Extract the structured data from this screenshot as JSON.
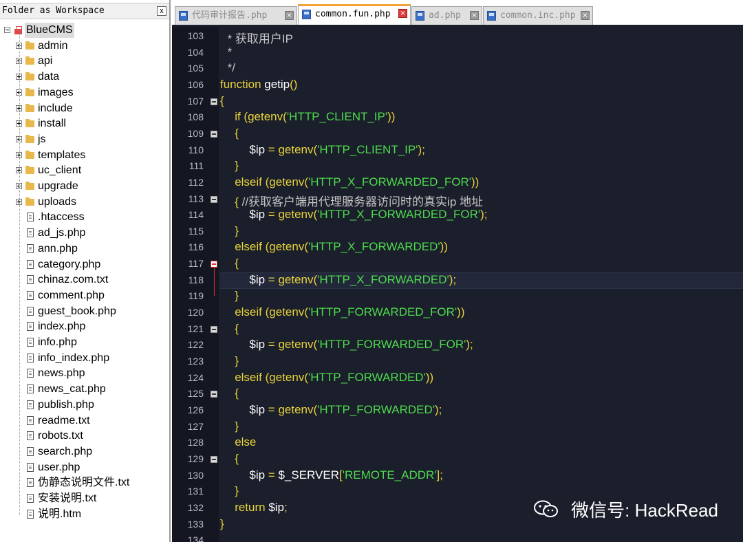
{
  "folder_panel": {
    "title": "Folder as Workspace",
    "close_label": "x",
    "root": "BlueCMS",
    "folders": [
      "admin",
      "api",
      "data",
      "images",
      "include",
      "install",
      "js",
      "templates",
      "uc_client",
      "upgrade",
      "uploads"
    ],
    "files": [
      ".htaccess",
      "ad_js.php",
      "ann.php",
      "category.php",
      "chinaz.com.txt",
      "comment.php",
      "guest_book.php",
      "index.php",
      "info.php",
      "info_index.php",
      "news.php",
      "news_cat.php",
      "publish.php",
      "readme.txt",
      "robots.txt",
      "search.php",
      "user.php",
      "伪静态说明文件.txt",
      "安装说明.txt",
      "说明.htm"
    ]
  },
  "tabs": [
    {
      "label": "代码审计报告.php",
      "active": false
    },
    {
      "label": "common.fun.php",
      "active": true
    },
    {
      "label": "ad.php",
      "active": false
    },
    {
      "label": "common.inc.php",
      "active": false
    }
  ],
  "editor": {
    "lines": [
      {
        "n": "103",
        "indent": 1,
        "tokens": [
          [
            "cm",
            "* 获取用户IP"
          ]
        ]
      },
      {
        "n": "104",
        "indent": 1,
        "tokens": [
          [
            "cm",
            "*"
          ]
        ]
      },
      {
        "n": "105",
        "indent": 1,
        "tokens": [
          [
            "cm",
            "*/"
          ]
        ]
      },
      {
        "n": "106",
        "indent": 0,
        "tokens": [
          [
            "kw",
            "function "
          ],
          [
            "fn",
            "getip"
          ],
          [
            "pn",
            "()"
          ]
        ]
      },
      {
        "n": "107",
        "indent": 0,
        "fold": "box",
        "tokens": [
          [
            "pn",
            "{"
          ]
        ]
      },
      {
        "n": "108",
        "indent": 2,
        "tokens": [
          [
            "kw",
            "if "
          ],
          [
            "pn",
            "("
          ],
          [
            "bf",
            "getenv"
          ],
          [
            "pn",
            "("
          ],
          [
            "st",
            "'HTTP_CLIENT_IP'"
          ],
          [
            "pn",
            "))"
          ]
        ]
      },
      {
        "n": "109",
        "indent": 2,
        "fold": "box",
        "tokens": [
          [
            "pn",
            "{"
          ]
        ]
      },
      {
        "n": "110",
        "indent": 4,
        "tokens": [
          [
            "vr",
            "$ip"
          ],
          [
            "op",
            " = "
          ],
          [
            "bf",
            "getenv"
          ],
          [
            "pn",
            "("
          ],
          [
            "st",
            "'HTTP_CLIENT_IP'"
          ],
          [
            "pn",
            ");"
          ]
        ]
      },
      {
        "n": "111",
        "indent": 2,
        "tokens": [
          [
            "pn",
            "}"
          ]
        ]
      },
      {
        "n": "112",
        "indent": 2,
        "tokens": [
          [
            "kw",
            "elseif "
          ],
          [
            "pn",
            "("
          ],
          [
            "bf",
            "getenv"
          ],
          [
            "pn",
            "("
          ],
          [
            "st",
            "'HTTP_X_FORWARDED_FOR'"
          ],
          [
            "pn",
            "))"
          ]
        ]
      },
      {
        "n": "113",
        "indent": 2,
        "fold": "box",
        "tokens": [
          [
            "pn",
            "{ "
          ],
          [
            "cm",
            "//获取客户端用代理服务器访问时的真实ip 地址"
          ]
        ]
      },
      {
        "n": "114",
        "indent": 4,
        "tokens": [
          [
            "vr",
            "$ip"
          ],
          [
            "op",
            " = "
          ],
          [
            "bf",
            "getenv"
          ],
          [
            "pn",
            "("
          ],
          [
            "st",
            "'HTTP_X_FORWARDED_FOR'"
          ],
          [
            "pn",
            ");"
          ]
        ]
      },
      {
        "n": "115",
        "indent": 2,
        "tokens": [
          [
            "pn",
            "}"
          ]
        ]
      },
      {
        "n": "116",
        "indent": 2,
        "tokens": [
          [
            "kw",
            "elseif "
          ],
          [
            "pn",
            "("
          ],
          [
            "bf",
            "getenv"
          ],
          [
            "pn",
            "("
          ],
          [
            "st",
            "'HTTP_X_FORWARDED'"
          ],
          [
            "pn",
            "))"
          ]
        ]
      },
      {
        "n": "117",
        "indent": 2,
        "fold": "red",
        "tokens": [
          [
            "pn",
            "{"
          ]
        ]
      },
      {
        "n": "118",
        "indent": 4,
        "highlight": true,
        "tokens": [
          [
            "vr",
            "$ip"
          ],
          [
            "op",
            " = "
          ],
          [
            "bf",
            "getenv"
          ],
          [
            "pn",
            "("
          ],
          [
            "st",
            "'HTTP_X_FORWARDED'"
          ],
          [
            "pn",
            ");"
          ]
        ]
      },
      {
        "n": "119",
        "indent": 2,
        "tokens": [
          [
            "pn",
            "}"
          ]
        ]
      },
      {
        "n": "120",
        "indent": 2,
        "tokens": [
          [
            "kw",
            "elseif "
          ],
          [
            "pn",
            "("
          ],
          [
            "bf",
            "getenv"
          ],
          [
            "pn",
            "("
          ],
          [
            "st",
            "'HTTP_FORWARDED_FOR'"
          ],
          [
            "pn",
            "))"
          ]
        ]
      },
      {
        "n": "121",
        "indent": 2,
        "fold": "box",
        "tokens": [
          [
            "pn",
            "{"
          ]
        ]
      },
      {
        "n": "122",
        "indent": 4,
        "tokens": [
          [
            "vr",
            "$ip"
          ],
          [
            "op",
            " = "
          ],
          [
            "bf",
            "getenv"
          ],
          [
            "pn",
            "("
          ],
          [
            "st",
            "'HTTP_FORWARDED_FOR'"
          ],
          [
            "pn",
            ");"
          ]
        ]
      },
      {
        "n": "123",
        "indent": 2,
        "tokens": [
          [
            "pn",
            "}"
          ]
        ]
      },
      {
        "n": "124",
        "indent": 2,
        "tokens": [
          [
            "kw",
            "elseif "
          ],
          [
            "pn",
            "("
          ],
          [
            "bf",
            "getenv"
          ],
          [
            "pn",
            "("
          ],
          [
            "st",
            "'HTTP_FORWARDED'"
          ],
          [
            "pn",
            "))"
          ]
        ]
      },
      {
        "n": "125",
        "indent": 2,
        "fold": "box",
        "tokens": [
          [
            "pn",
            "{"
          ]
        ]
      },
      {
        "n": "126",
        "indent": 4,
        "tokens": [
          [
            "vr",
            "$ip"
          ],
          [
            "op",
            " = "
          ],
          [
            "bf",
            "getenv"
          ],
          [
            "pn",
            "("
          ],
          [
            "st",
            "'HTTP_FORWARDED'"
          ],
          [
            "pn",
            ");"
          ]
        ]
      },
      {
        "n": "127",
        "indent": 2,
        "tokens": [
          [
            "pn",
            "}"
          ]
        ]
      },
      {
        "n": "128",
        "indent": 2,
        "tokens": [
          [
            "kw",
            "else"
          ]
        ]
      },
      {
        "n": "129",
        "indent": 2,
        "fold": "box",
        "tokens": [
          [
            "pn",
            "{"
          ]
        ]
      },
      {
        "n": "130",
        "indent": 4,
        "tokens": [
          [
            "vr",
            "$ip"
          ],
          [
            "op",
            " = "
          ],
          [
            "vr",
            "$_SERVER"
          ],
          [
            "pn",
            "["
          ],
          [
            "st",
            "'REMOTE_ADDR'"
          ],
          [
            "pn",
            "];"
          ]
        ]
      },
      {
        "n": "131",
        "indent": 2,
        "tokens": [
          [
            "pn",
            "}"
          ]
        ]
      },
      {
        "n": "132",
        "indent": 2,
        "tokens": [
          [
            "kw",
            "return "
          ],
          [
            "vr",
            "$ip"
          ],
          [
            "pn",
            ";"
          ]
        ]
      },
      {
        "n": "133",
        "indent": 0,
        "tokens": [
          [
            "pn",
            "}"
          ]
        ]
      },
      {
        "n": "134",
        "indent": 0,
        "tokens": []
      }
    ]
  },
  "watermark": {
    "text": "微信号: HackRead",
    "icon": "wechat-icon"
  },
  "colors": {
    "editor_bg": "#1b1e2b",
    "keyword": "#e7d33b",
    "string": "#4ddc4d",
    "comment": "#c7c7c7",
    "active_tab_accent": "#f2a33a"
  }
}
